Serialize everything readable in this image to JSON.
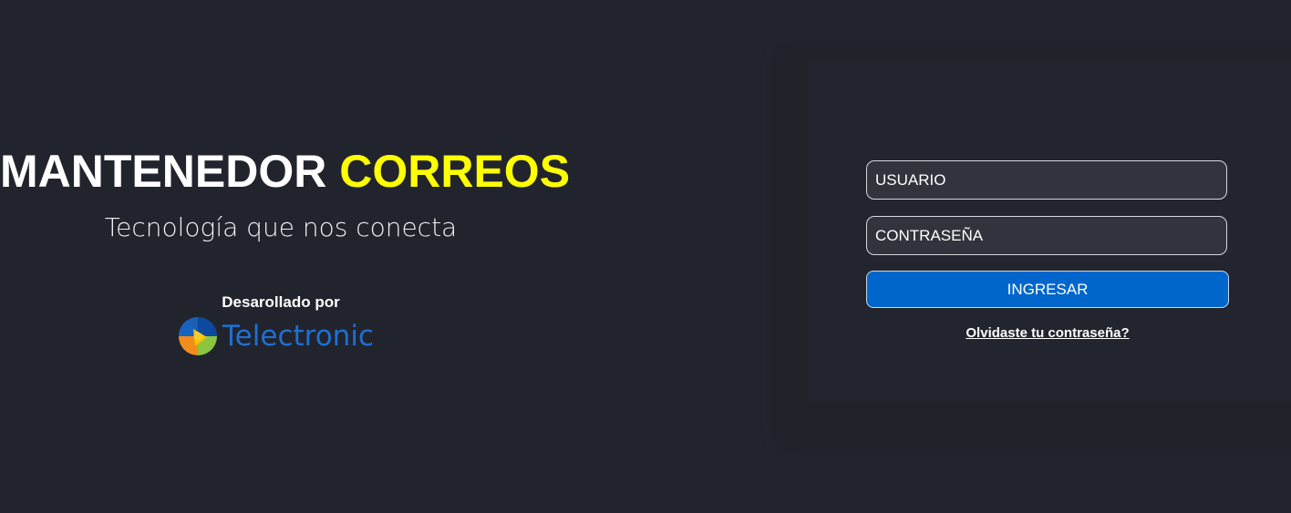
{
  "hero": {
    "title_part1": "MANTENEDOR",
    "title_part2": "CORREOS",
    "subtitle": "Tecnología que nos conecta",
    "developed_by": "Desarollado por",
    "brand_name": "Telectronic"
  },
  "login": {
    "username_placeholder": "USUARIO",
    "password_placeholder": "CONTRASEÑA",
    "submit_label": "INGRESAR",
    "forgot_link": "Olvidaste tu contraseña?"
  },
  "colors": {
    "background": "#21242d",
    "accent_yellow": "#ffff00",
    "button_blue": "#0066cc",
    "brand_blue": "#1f6fd1"
  }
}
